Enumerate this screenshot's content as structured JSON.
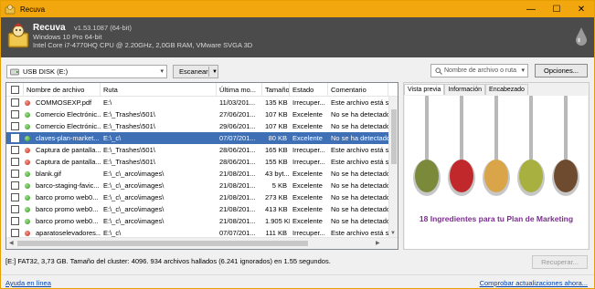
{
  "window": {
    "title": "Recuva",
    "controls": {
      "minimize": "—",
      "maximize": "☐",
      "close": "✕"
    }
  },
  "header": {
    "app_name": "Recuva",
    "version": "v1.53.1087 (64-bit)",
    "os": "Windows 10 Pro 64-bit",
    "cpu": "Intel Core i7-4770HQ CPU @ 2.20GHz, 2,0GB RAM, VMware SVGA 3D"
  },
  "toolbar": {
    "drive": "USB DISK (E:)",
    "scan_label": "Escanear",
    "search_placeholder": "Nombre de archivo o ruta",
    "options_label": "Opciones..."
  },
  "columns": [
    "Nombre de archivo",
    "Ruta",
    "Última mo...",
    "Tamaño",
    "Estado",
    "Comentario"
  ],
  "files": [
    {
      "name": "COMMOSEXP.pdf",
      "path": "E:\\",
      "modified": "11/03/201...",
      "size": "135 KB",
      "state": "Irrecuper...",
      "comment": "Este archivo está so",
      "status": "red",
      "selected": false
    },
    {
      "name": "Comercio Electrónic...",
      "path": "E:\\_Trashes\\501\\",
      "modified": "27/06/201...",
      "size": "107 KB",
      "state": "Excelente",
      "comment": "No se ha detectado",
      "status": "green",
      "selected": false
    },
    {
      "name": "Comercio Electrónic...",
      "path": "E:\\_Trashes\\501\\",
      "modified": "29/06/201...",
      "size": "107 KB",
      "state": "Excelente",
      "comment": "No se ha detectado",
      "status": "green",
      "selected": false
    },
    {
      "name": "claves-plan-market...",
      "path": "E:\\_c\\",
      "modified": "07/07/201...",
      "size": "80 KB",
      "state": "Excelente",
      "comment": "No se ha detectado",
      "status": "green",
      "selected": true
    },
    {
      "name": "Captura de pantalla...",
      "path": "E:\\_Trashes\\501\\",
      "modified": "28/06/201...",
      "size": "165 KB",
      "state": "Irrecuper...",
      "comment": "Este archivo está so",
      "status": "red",
      "selected": false
    },
    {
      "name": "Captura de pantalla...",
      "path": "E:\\_Trashes\\501\\",
      "modified": "28/06/201...",
      "size": "155 KB",
      "state": "Irrecuper...",
      "comment": "Este archivo está so",
      "status": "red",
      "selected": false
    },
    {
      "name": "blank.gif",
      "path": "E:\\_c\\_arco\\images\\",
      "modified": "21/08/201...",
      "size": "43 byt...",
      "state": "Excelente",
      "comment": "No se ha detectado",
      "status": "green",
      "selected": false
    },
    {
      "name": "barco-staging-favic...",
      "path": "E:\\_c\\_arco\\images\\",
      "modified": "21/08/201...",
      "size": "5 KB",
      "state": "Excelente",
      "comment": "No se ha detectado",
      "status": "green",
      "selected": false
    },
    {
      "name": "barco promo web0...",
      "path": "E:\\_c\\_arco\\images\\",
      "modified": "21/08/201...",
      "size": "273 KB",
      "state": "Excelente",
      "comment": "No se ha detectado",
      "status": "green",
      "selected": false
    },
    {
      "name": "barco promo web0...",
      "path": "E:\\_c\\_arco\\images\\",
      "modified": "21/08/201...",
      "size": "413 KB",
      "state": "Excelente",
      "comment": "No se ha detectado",
      "status": "green",
      "selected": false
    },
    {
      "name": "barco promo web0...",
      "path": "E:\\_c\\_arco\\images\\",
      "modified": "21/08/201...",
      "size": "1.905 KB",
      "state": "Excelente",
      "comment": "No se ha detectado",
      "status": "green",
      "selected": false
    },
    {
      "name": "aparatoselevadores...",
      "path": "E:\\_c\\",
      "modified": "07/07/201...",
      "size": "111 KB",
      "state": "Irrecuper...",
      "comment": "Este archivo está so",
      "status": "red",
      "selected": false
    }
  ],
  "preview": {
    "tabs": [
      "Vista previa",
      "Información",
      "Encabezado"
    ],
    "caption": "18 Ingredientes para tu Plan de Marketing",
    "spice_colors": [
      "#7a8a3a",
      "#c0282b",
      "#d9a548",
      "#a8b040",
      "#6e4a2e"
    ]
  },
  "status_text": "[E:] FAT32, 3,73 GB. Tamaño del cluster: 4096. 934 archivos hallados (6.241 ignorados) en 1.55 segundos.",
  "recover_label": "Recuperar...",
  "footer": {
    "help_link": "Ayuda en línea",
    "update_link": "Comprobar actualizaciones ahora..."
  }
}
